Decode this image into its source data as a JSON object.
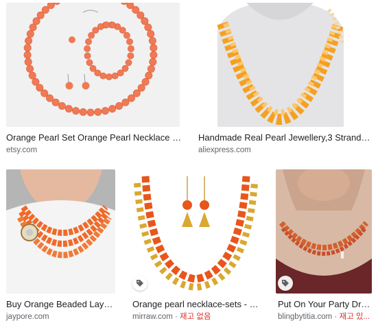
{
  "results": [
    {
      "title": "Orange Pearl Set Orange Pearl Necklace Ora...",
      "source": "etsy.com",
      "image": "orange-pearl-necklace-bracelet-earrings"
    },
    {
      "title": "Handmade Real Pearl Jewellery,3 Strands,2...",
      "source": "aliexpress.com",
      "image": "orange-baroque-pearl-necklace-on-bust"
    },
    {
      "title": "Buy Orange Beaded Layer...",
      "source": "jaypore.com",
      "image": "layered-orange-bead-necklace-worn"
    },
    {
      "title": "Orange pearl necklace-sets - Su...",
      "source": "mirraw.com",
      "stock": "재고 없음",
      "image": "orange-bead-gold-triangle-necklace-set",
      "tag_icon": "price-tag-icon"
    },
    {
      "title": "Put On Your Party Dres...",
      "source": "blingbytitia.com",
      "stock": "재고 있...",
      "image": "orange-pearl-choker-worn",
      "tag_icon": "price-tag-icon"
    }
  ],
  "separator": " · ",
  "colors": {
    "stock_status": "#d93025",
    "title": "#202124",
    "source": "#5f6368"
  }
}
